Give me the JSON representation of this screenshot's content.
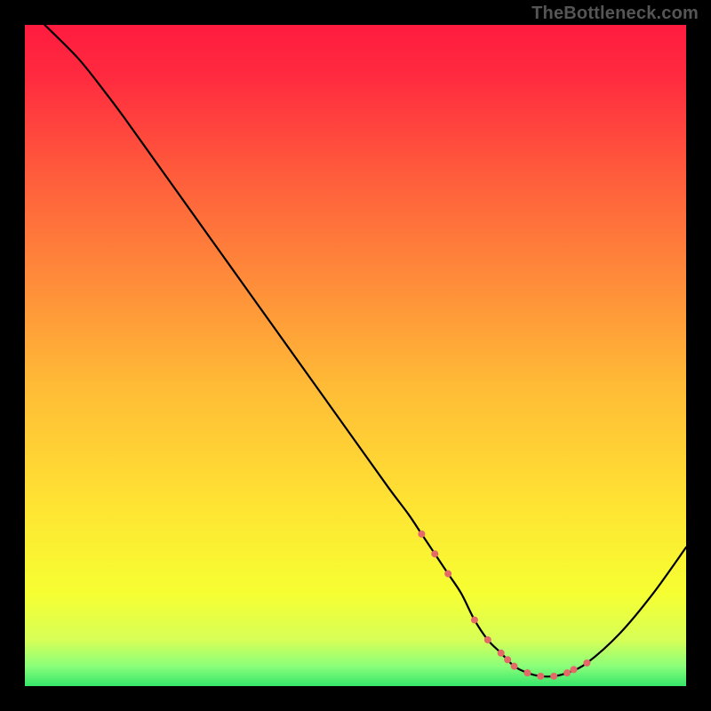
{
  "watermark": "TheBottleneck.com",
  "chart_data": {
    "type": "line",
    "title": "",
    "xlabel": "",
    "ylabel": "",
    "xlim": [
      0,
      100
    ],
    "ylim": [
      0,
      100
    ],
    "x": [
      3,
      8,
      12,
      15,
      20,
      25,
      30,
      35,
      40,
      45,
      50,
      55,
      58,
      60,
      62,
      64,
      66,
      68,
      70,
      72,
      74,
      76,
      78,
      80,
      82,
      85,
      90,
      95,
      100
    ],
    "values": [
      100,
      95,
      90,
      86,
      79,
      72,
      65,
      58,
      51,
      44,
      37,
      30,
      26,
      23,
      20,
      17,
      14,
      10,
      7,
      5,
      3,
      2,
      1.5,
      1.5,
      2,
      3.5,
      8,
      14,
      21
    ],
    "markers": {
      "x": [
        60,
        62,
        64,
        68,
        70,
        72,
        73,
        74,
        76,
        78,
        80,
        82,
        83,
        85
      ],
      "values": [
        23,
        20,
        17,
        10,
        7,
        5,
        4,
        3,
        2,
        1.5,
        1.5,
        2,
        2.5,
        3.5
      ],
      "lying_on_curve": true
    },
    "background": {
      "type": "vertical-gradient",
      "stops": [
        {
          "offset": 0.0,
          "color": "#ff1b3f"
        },
        {
          "offset": 0.08,
          "color": "#ff2b3f"
        },
        {
          "offset": 0.22,
          "color": "#ff5a3c"
        },
        {
          "offset": 0.38,
          "color": "#ff8a3a"
        },
        {
          "offset": 0.55,
          "color": "#ffbc36"
        },
        {
          "offset": 0.72,
          "color": "#ffe233"
        },
        {
          "offset": 0.86,
          "color": "#f6ff32"
        },
        {
          "offset": 0.93,
          "color": "#d7ff57"
        },
        {
          "offset": 0.97,
          "color": "#8aff7a"
        },
        {
          "offset": 1.0,
          "color": "#36e56a"
        }
      ]
    },
    "line_color": "#000000",
    "line_width": 2.2,
    "marker_color": "#e46a68",
    "marker_radius": 4
  }
}
